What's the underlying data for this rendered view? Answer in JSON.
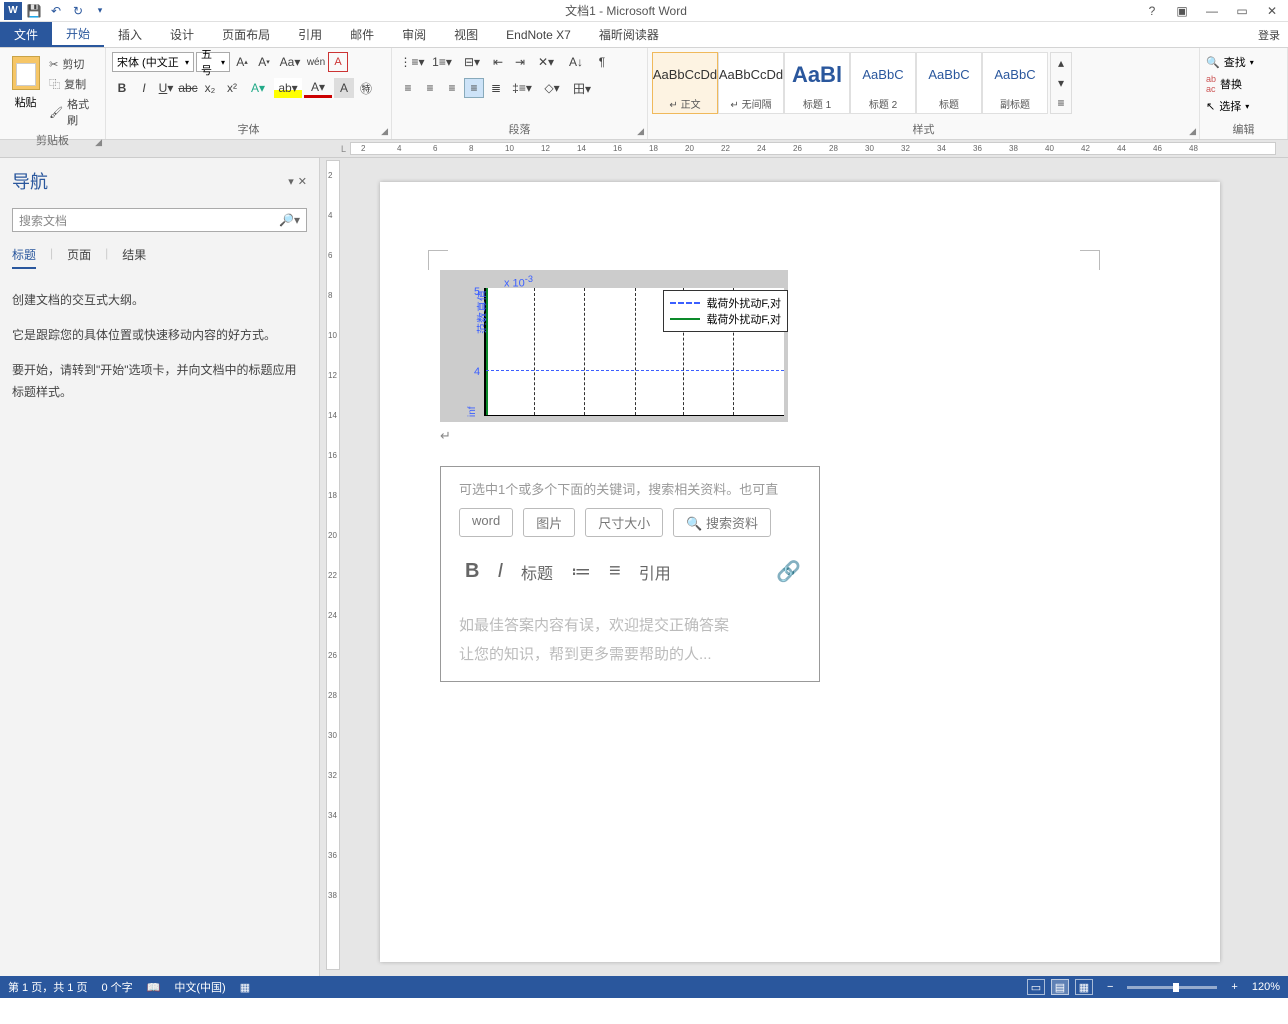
{
  "titlebar": {
    "title": "文档1 - Microsoft Word"
  },
  "wincontrols": {
    "help": "?",
    "ribbon": "▣",
    "min": "―",
    "restore": "▭",
    "close": "✕"
  },
  "tabs": {
    "file": "文件",
    "home": "开始",
    "insert": "插入",
    "design": "设计",
    "layout": "页面布局",
    "references": "引用",
    "mailings": "邮件",
    "review": "审阅",
    "view": "视图",
    "endnote": "EndNote X7",
    "foxit": "福昕阅读器",
    "login": "登录"
  },
  "ribbon": {
    "clipboard": {
      "paste": "粘贴",
      "cut": "剪切",
      "copy": "复制",
      "format_painter": "格式刷",
      "label": "剪贴板"
    },
    "font": {
      "name": "宋体 (中文正",
      "size": "五号",
      "label": "字体"
    },
    "paragraph": {
      "label": "段落"
    },
    "styles": {
      "label": "样式",
      "items": [
        {
          "preview": "AaBbCcDd",
          "label": "↵ 正文",
          "sel": true,
          "cls": ""
        },
        {
          "preview": "AaBbCcDd",
          "label": "↵ 无间隔",
          "sel": false,
          "cls": ""
        },
        {
          "preview": "AaBl",
          "label": "标题 1",
          "sel": false,
          "cls": "big blue"
        },
        {
          "preview": "AaBbC",
          "label": "标题 2",
          "sel": false,
          "cls": "blue"
        },
        {
          "preview": "AaBbC",
          "label": "标题",
          "sel": false,
          "cls": "blue"
        },
        {
          "preview": "AaBbC",
          "label": "副标题",
          "sel": false,
          "cls": "blue"
        }
      ]
    },
    "editing": {
      "find": "查找",
      "replace": "替换",
      "select": "选择",
      "label": "编辑"
    }
  },
  "nav": {
    "title": "导航",
    "search_placeholder": "搜索文档",
    "tabs": {
      "headings": "标题",
      "pages": "页面",
      "results": "结果"
    },
    "body": {
      "l1": "创建文档的交互式大纲。",
      "l2": "它是跟踪您的具体位置或快速移动内容的好方式。",
      "l3": "要开始，请转到\"开始\"选项卡，并向文档中的标题应用标题样式。"
    }
  },
  "chart_data": {
    "type": "line",
    "title": "",
    "xlabel": "",
    "ylabel_main": "范数真值",
    "ylabel_sub": "inf",
    "exponent": "x 10",
    "exponent_sup": "-3",
    "yticks": [
      5,
      4
    ],
    "ylim": [
      3.5,
      5
    ],
    "series": [
      {
        "name": "载荷外扰动F,对",
        "style": "dash-blue"
      },
      {
        "name": "载荷外扰动F,对",
        "style": "solid-green"
      }
    ]
  },
  "snippet": {
    "hint": "可选中1个或多个下面的关键词，搜索相关资料。也可直",
    "tags": {
      "word": "word",
      "image": "图片",
      "size": "尺寸大小",
      "search": "搜索资料"
    },
    "toolbar": {
      "bold": "B",
      "italic": "I",
      "heading": "标题",
      "ol": "≡",
      "ul": "≡",
      "quote": "引用"
    },
    "body1": "如最佳答案内容有误，欢迎提交正确答案",
    "body2": "让您的知识，帮到更多需要帮助的人..."
  },
  "status": {
    "page": "第 1 页，共 1 页",
    "words": "0 个字",
    "lang": "中文(中国)",
    "zoom": "120%"
  }
}
